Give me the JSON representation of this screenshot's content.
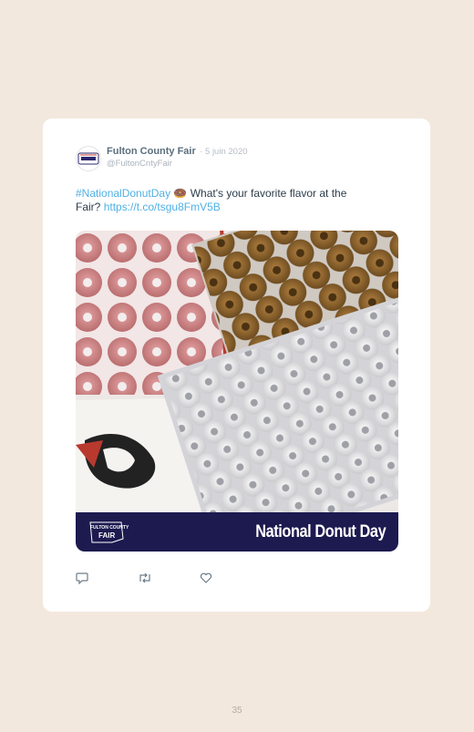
{
  "tweet": {
    "display_name": "Fulton County Fair",
    "date": "· 5 juin 2020",
    "handle": "@FultonCntyFair",
    "hashtag": "#NationalDonutDay",
    "emoji": "🍩",
    "text_part1": " What's your favorite flavor at the",
    "text_part2": "Fair? ",
    "link": "https://t.co/tsgu8FmV5B"
  },
  "media": {
    "banner_title": "National Donut Day",
    "logo_line1": "FULTON COUNTY",
    "logo_line2": "FAIR"
  },
  "actions": [
    "reply-icon",
    "retweet-icon",
    "like-icon"
  ],
  "page_number": "35",
  "colors": {
    "background": "#f3e8de",
    "link": "#4fb0e4",
    "banner": "#1c1a4f"
  }
}
